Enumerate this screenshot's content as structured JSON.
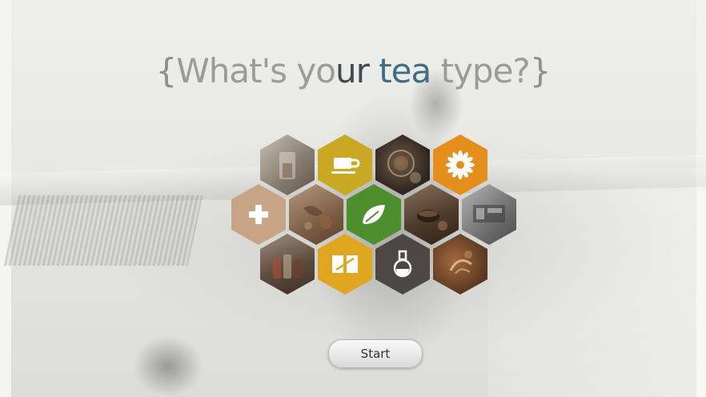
{
  "title": {
    "open_brace": "{",
    "part1": "What's yo",
    "part2": "ur",
    "part3": " ",
    "part4": "tea",
    "part5": " type?",
    "close_brace": "}"
  },
  "start_button": {
    "label": "Start"
  },
  "tiles": [
    {
      "name": "tile-tea-glass-photo",
      "icon": "tea-glass-photo",
      "color": "#a49a8c"
    },
    {
      "name": "tile-teacup",
      "icon": "teacup-icon",
      "color": "#c9a923"
    },
    {
      "name": "tile-teapot-photo",
      "icon": "teapot-photo",
      "color": "#4b3b2f"
    },
    {
      "name": "tile-flower",
      "icon": "flower-icon",
      "color": "#e58d1d"
    },
    {
      "name": "tile-health",
      "icon": "plus-icon",
      "color": "#c8a487"
    },
    {
      "name": "tile-herbs-photo",
      "icon": "herbs-photo",
      "color": "#8a6a4e"
    },
    {
      "name": "tile-leaf",
      "icon": "leaf-icon",
      "color": "#4d8f2c"
    },
    {
      "name": "tile-tea-cup-photo",
      "icon": "tea-cup-photo",
      "color": "#5c4433"
    },
    {
      "name": "tile-tea-shop-photo",
      "icon": "tea-shop-photo",
      "color": "#7d7d7d"
    },
    {
      "name": "tile-jars-photo",
      "icon": "jars-photo",
      "color": "#6e5a4c"
    },
    {
      "name": "tile-book",
      "icon": "book-icon",
      "color": "#e0a61f"
    },
    {
      "name": "tile-flask",
      "icon": "flask-icon",
      "color": "#4d4846"
    },
    {
      "name": "tile-ginseng-photo",
      "icon": "ginseng-photo",
      "color": "#7a4e30"
    }
  ]
}
